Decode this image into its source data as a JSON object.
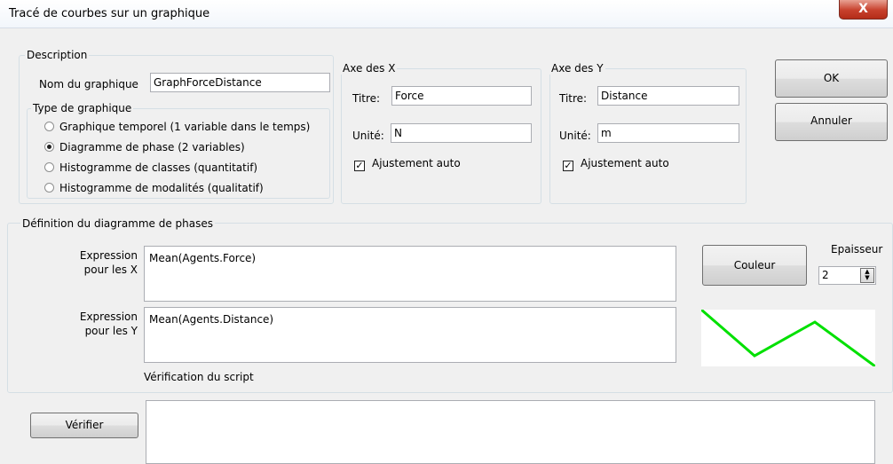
{
  "window": {
    "title": "Tracé de courbes sur un graphique",
    "close_glyph": "X"
  },
  "description": {
    "group_label": "Description",
    "name_label": "Nom du graphique",
    "name_value": "GraphForceDistance",
    "type_group_label": "Type de graphique",
    "types": [
      {
        "label": "Graphique temporel (1 variable dans le temps)",
        "selected": false
      },
      {
        "label": "Diagramme de phase (2 variables)",
        "selected": true
      },
      {
        "label": "Histogramme de classes (quantitatif)",
        "selected": false
      },
      {
        "label": "Histogramme de modalités (qualitatif)",
        "selected": false
      }
    ]
  },
  "x_axis": {
    "group_label": "Axe des X",
    "title_label": "Titre:",
    "title_value": "Force",
    "unit_label": "Unité:",
    "unit_value": "N",
    "auto_label": "Ajustement auto",
    "auto_checked": true
  },
  "y_axis": {
    "group_label": "Axe des Y",
    "title_label": "Titre:",
    "title_value": "Distance",
    "unit_label": "Unité:",
    "unit_value": "m",
    "auto_label": "Ajustement auto",
    "auto_checked": true
  },
  "buttons": {
    "ok": "OK",
    "cancel": "Annuler",
    "color": "Couleur",
    "verify": "Vérifier"
  },
  "phase": {
    "group_label": "Définition du diagramme de phases",
    "expr_x_label_1": "Expression",
    "expr_x_label_2": "pour les X",
    "expr_x_value": "Mean(Agents.Force)",
    "expr_y_label_1": "Expression",
    "expr_y_label_2": "pour les Y",
    "expr_y_value": "Mean(Agents.Distance)",
    "thickness_label": "Epaisseur",
    "thickness_value": "2",
    "script_check_label": "Vérification du script",
    "line_color": "#00e000"
  },
  "verify_output": ""
}
